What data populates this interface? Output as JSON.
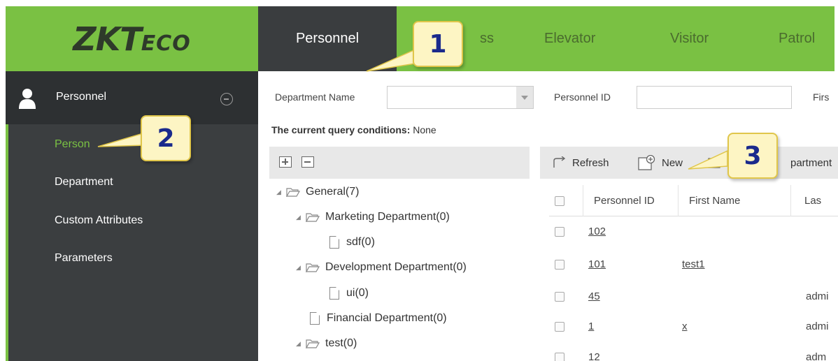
{
  "app": {
    "logo_main": "ZKT",
    "logo_suffix": "ECO"
  },
  "topnav": {
    "personnel": "Personnel",
    "access": "ss",
    "elevator": "Elevator",
    "visitor": "Visitor",
    "patrol": "Patrol"
  },
  "sidebar": {
    "header": "Personnel",
    "items": [
      {
        "label": "Person",
        "active": true
      },
      {
        "label": "Department",
        "active": false
      },
      {
        "label": "Custom Attributes",
        "active": false
      },
      {
        "label": "Parameters",
        "active": false
      }
    ]
  },
  "filters": {
    "dept_label": "Department Name",
    "dept_value": "",
    "pid_label": "Personnel ID",
    "pid_value": "",
    "first_label": "Firs",
    "query_prefix": "The current query conditions:",
    "query_value": "None"
  },
  "tree": [
    {
      "label": "General(7)",
      "type": "folder"
    },
    {
      "label": "Marketing Department(0)",
      "type": "folder"
    },
    {
      "label": "sdf(0)",
      "type": "file"
    },
    {
      "label": "Development Department(0)",
      "type": "folder"
    },
    {
      "label": "ui(0)",
      "type": "file"
    },
    {
      "label": "Financial Department(0)",
      "type": "file"
    },
    {
      "label": "test(0)",
      "type": "folder"
    }
  ],
  "grid": {
    "toolbar": {
      "refresh": "Refresh",
      "new": "New",
      "dept": "partment"
    },
    "columns": [
      "Personnel ID",
      "First Name",
      "Las"
    ],
    "rows": [
      {
        "id": "102",
        "first": "",
        "last": ""
      },
      {
        "id": "101",
        "first": "test1",
        "last": ""
      },
      {
        "id": "45",
        "first": "",
        "last": "admi"
      },
      {
        "id": "1",
        "first": "x",
        "last": "admi"
      },
      {
        "id": "12",
        "first": "",
        "last": "adm"
      }
    ]
  },
  "callouts": [
    "1",
    "2",
    "3"
  ],
  "colors": {
    "brand_green": "#7ac143",
    "sidebar_dark": "#3b3e40",
    "callout_fill": "#fdf5c4",
    "callout_number": "#1a2a8c"
  }
}
